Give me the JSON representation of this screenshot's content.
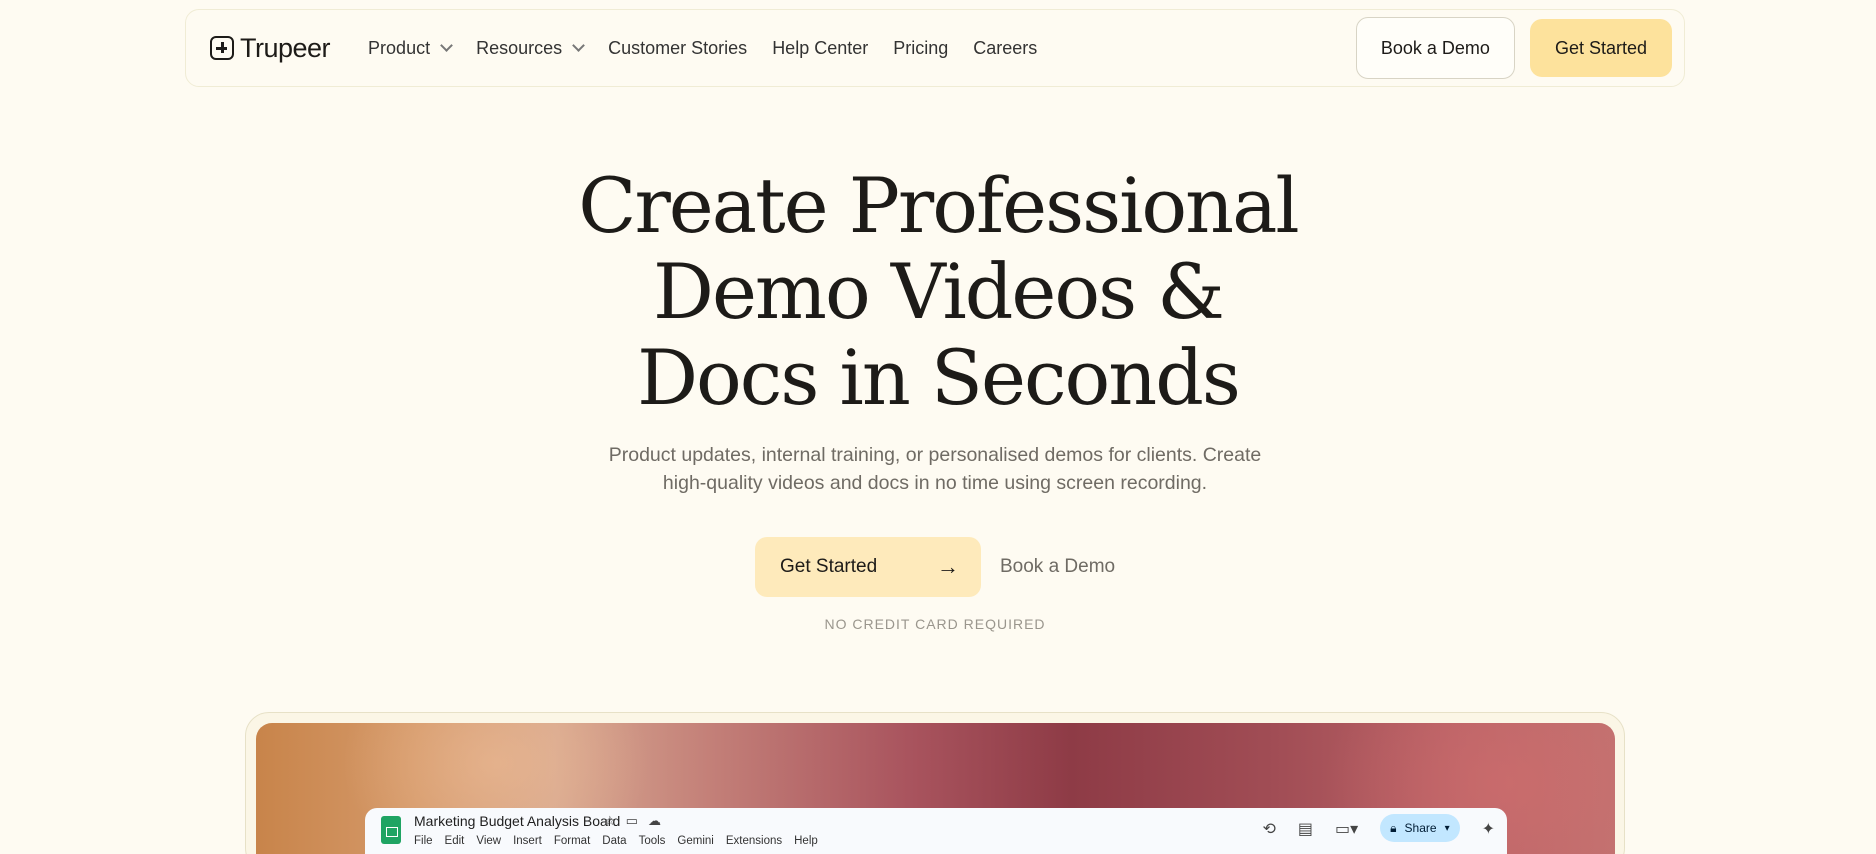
{
  "nav": {
    "logo": "Trupeer",
    "items": [
      {
        "label": "Product",
        "dropdown": true
      },
      {
        "label": "Resources",
        "dropdown": true
      },
      {
        "label": "Customer Stories",
        "dropdown": false
      },
      {
        "label": "Help Center",
        "dropdown": false
      },
      {
        "label": "Pricing",
        "dropdown": false
      },
      {
        "label": "Careers",
        "dropdown": false
      }
    ],
    "book_demo": "Book a Demo",
    "get_started": "Get Started"
  },
  "hero": {
    "title_lines": [
      "Create Professional",
      "Demo Videos &",
      "Docs in Seconds"
    ],
    "subtitle_line1": "Product updates, internal training, or personalised demos for clients. Create",
    "subtitle_line2": "high-quality videos and docs in no time using screen recording.",
    "cta_primary": "Get Started",
    "cta_arrow": "→",
    "cta_secondary": "Book a Demo",
    "note": "NO CREDIT CARD REQUIRED"
  },
  "preview": {
    "sheet_title": "Marketing Budget Analysis Board",
    "menu": [
      "File",
      "Edit",
      "View",
      "Insert",
      "Format",
      "Data",
      "Tools",
      "Gemini",
      "Extensions",
      "Help"
    ],
    "share_label": "Share"
  },
  "colors": {
    "background": "#fefbf2",
    "accent": "#fde29c",
    "cta": "#feeabb",
    "text": "#1d1b18",
    "muted": "#6f6b64"
  }
}
